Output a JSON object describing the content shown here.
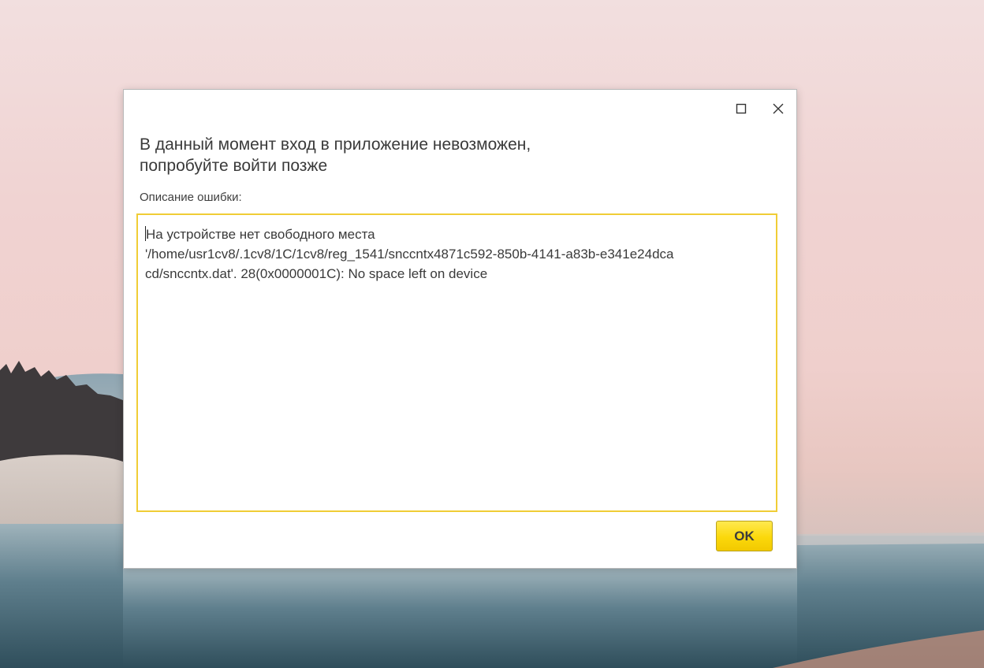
{
  "dialog": {
    "heading_line1": "В данный момент вход в приложение невозможен,",
    "heading_line2": "попробуйте войти позже",
    "description_label": "Описание ошибки:",
    "error_line1": "На устройстве нет свободного места",
    "error_line2": "'/home/usr1cv8/.1cv8/1C/1cv8/reg_1541/snccntx4871c592-850b-4141-a83b-e341e24dca",
    "error_line3": "cd/snccntx.dat'. 28(0x0000001C): No space left on device",
    "ok_label": "OK"
  },
  "icons": {
    "maximize": "maximize-icon",
    "close": "close-icon"
  },
  "colors": {
    "accent_border": "#f0cd36",
    "ok_button": "#fbd80b",
    "text": "#3a3a3a"
  }
}
